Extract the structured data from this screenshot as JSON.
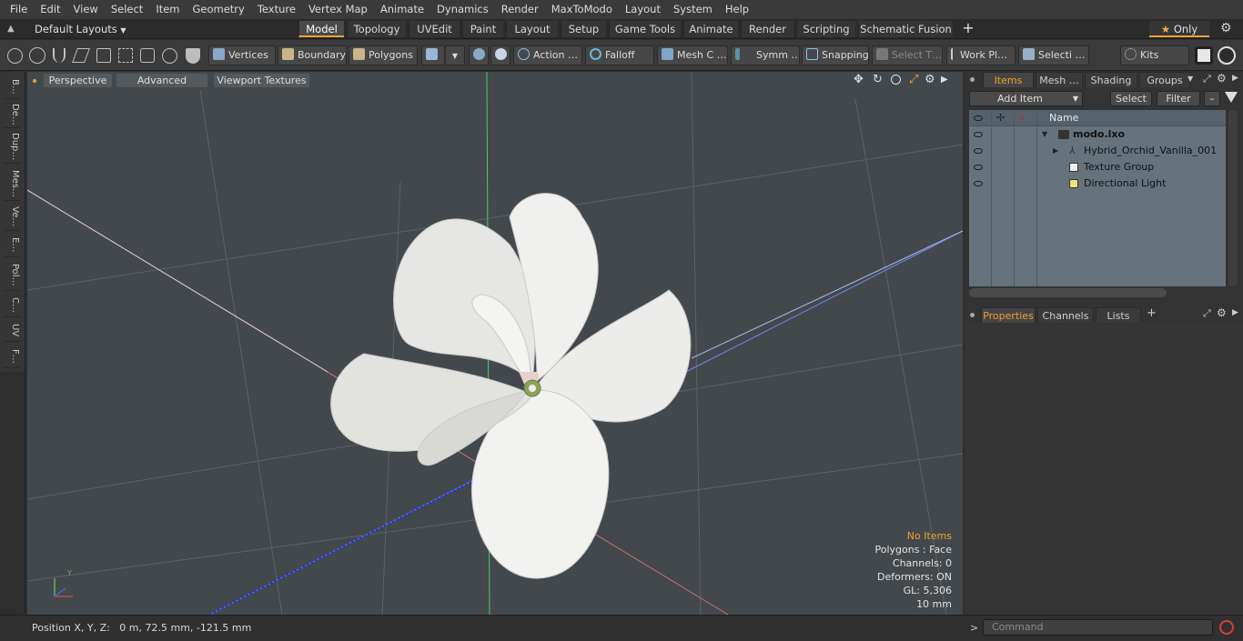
{
  "menu": [
    "File",
    "Edit",
    "View",
    "Select",
    "Item",
    "Geometry",
    "Texture",
    "Vertex Map",
    "Animate",
    "Dynamics",
    "Render",
    "MaxToModo",
    "Layout",
    "System",
    "Help"
  ],
  "layouts": {
    "dropdown": "Default Layouts",
    "tabs": [
      "Model",
      "Topology",
      "UVEdit",
      "Paint",
      "Layout",
      "Setup",
      "Game Tools",
      "Animate",
      "Render",
      "Scripting",
      "Schematic Fusion"
    ],
    "active": "Model",
    "add": "+",
    "only": "Only"
  },
  "toolbar": {
    "vertices": "Vertices",
    "boundary": "Boundary",
    "polygons": "Polygons",
    "action": "Action",
    "action_more": "…",
    "falloff": "Falloff",
    "mesh": "Mesh C …",
    "symm": "Symm …",
    "snapping": "Snapping",
    "select_t": "Select T…",
    "work_pl": "Work Pl…",
    "selecti": "Selecti …",
    "kits": "Kits"
  },
  "left_tabs": [
    "B…",
    "De…",
    "Dup…",
    "Mes…",
    "Ve…",
    "E…",
    "Pol…",
    "C…",
    "UV",
    "F…"
  ],
  "viewport": {
    "perspective": "Perspective",
    "advanced": "Advanced",
    "textures": "Viewport Textures",
    "axis_y": "Y"
  },
  "hud": {
    "no_items": "No Items",
    "polygons": "Polygons : Face",
    "channels": "Channels: 0",
    "deformers": "Deformers: ON",
    "gl": "GL: 5,306",
    "scale": "10 mm"
  },
  "status": {
    "position": "Position X, Y, Z:   0 m, 72.5 mm, -121.5 mm"
  },
  "items_panel": {
    "tabs": [
      "Items",
      "Mesh …",
      "Shading",
      "Groups"
    ],
    "add_item": "Add Item",
    "select": "Select",
    "filter": "Filter",
    "column_name": "Name",
    "rows": [
      {
        "label": "modo.lxo",
        "bold": true
      },
      {
        "label": "Hybrid_Orchid_Vanilla_001"
      },
      {
        "label": "Texture Group"
      },
      {
        "label": "Directional Light"
      }
    ]
  },
  "props_panel": {
    "tabs": [
      "Properties",
      "Channels",
      "Lists"
    ],
    "add": "+"
  },
  "command": {
    "prompt": ">",
    "placeholder": "Command"
  },
  "colors": {
    "accent": "#f0a030",
    "viewport_bg": "#43484c",
    "list_bg": "#66737d"
  }
}
